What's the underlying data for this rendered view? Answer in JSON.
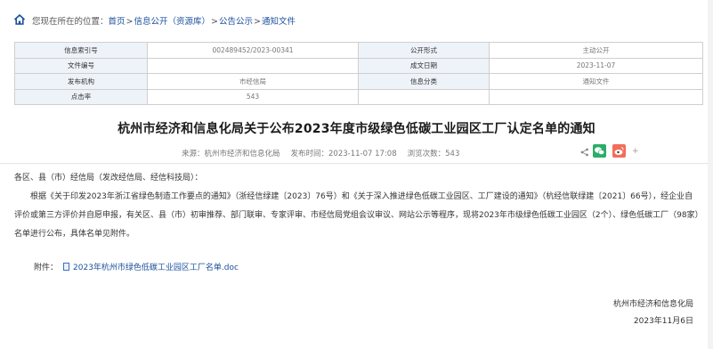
{
  "breadcrumb": {
    "prefix": "您现在所在的位置：",
    "items": [
      "首页",
      "信息公开（资源库）",
      "公告公示",
      "通知文件"
    ],
    "separator": ">"
  },
  "info": {
    "rows": [
      {
        "label1": "信息索引号",
        "value1": "002489452/2023-00341",
        "label2": "公开形式",
        "value2": "主动公开"
      },
      {
        "label1": "文件编号",
        "value1": "",
        "label2": "成文日期",
        "value2": "2023-11-07"
      },
      {
        "label1": "发布机构",
        "value1": "市经信局",
        "label2": "信息分类",
        "value2": "通知文件"
      },
      {
        "label1": "点击率",
        "value1": "543",
        "label2": "",
        "value2": ""
      }
    ]
  },
  "article": {
    "title": "杭州市经济和信息化局关于公布2023年度市级绿色低碳工业园区工厂认定名单的通知",
    "source": "来源：杭州市经济和信息化局",
    "publish_time": "发布时间：2023-11-07 17:08",
    "views": "浏览次数：543",
    "salutation": "各区、县（市）经信局（发改经信局、经信科技局）：",
    "paragraph": "根据《关于印发2023年浙江省绿色制造工作要点的通知》（浙经信绿建〔2023〕76号）和《关于深入推进绿色低碳工业园区、工厂建设的通知》（杭经信联绿建〔2021〕66号），经企业自评价或第三方评价并自愿申报，有关区、县（市）初审推荐、部门联审、专家评审、市经信局党组会议审议、网站公示等程序，现将2023年市级绿色低碳工业园区（2个）、绿色低碳工厂（98家）名单进行公布，具体名单见附件。",
    "attachment_label": "附件：",
    "attachment_link": "2023年杭州市绿色低碳工业园区工厂名单.doc",
    "signature": "杭州市经济和信息化局",
    "date": "2023年11月6日"
  },
  "share": {
    "icons": [
      "share-icon",
      "wechat-icon",
      "weibo-icon",
      "plus-icon"
    ],
    "colors": {
      "wechat": "#2aae67",
      "weibo": "#e6162d"
    }
  },
  "colors": {
    "link": "#1a4f9c",
    "table_label_bg": "#eef3f9",
    "border": "#cfcfcf"
  }
}
